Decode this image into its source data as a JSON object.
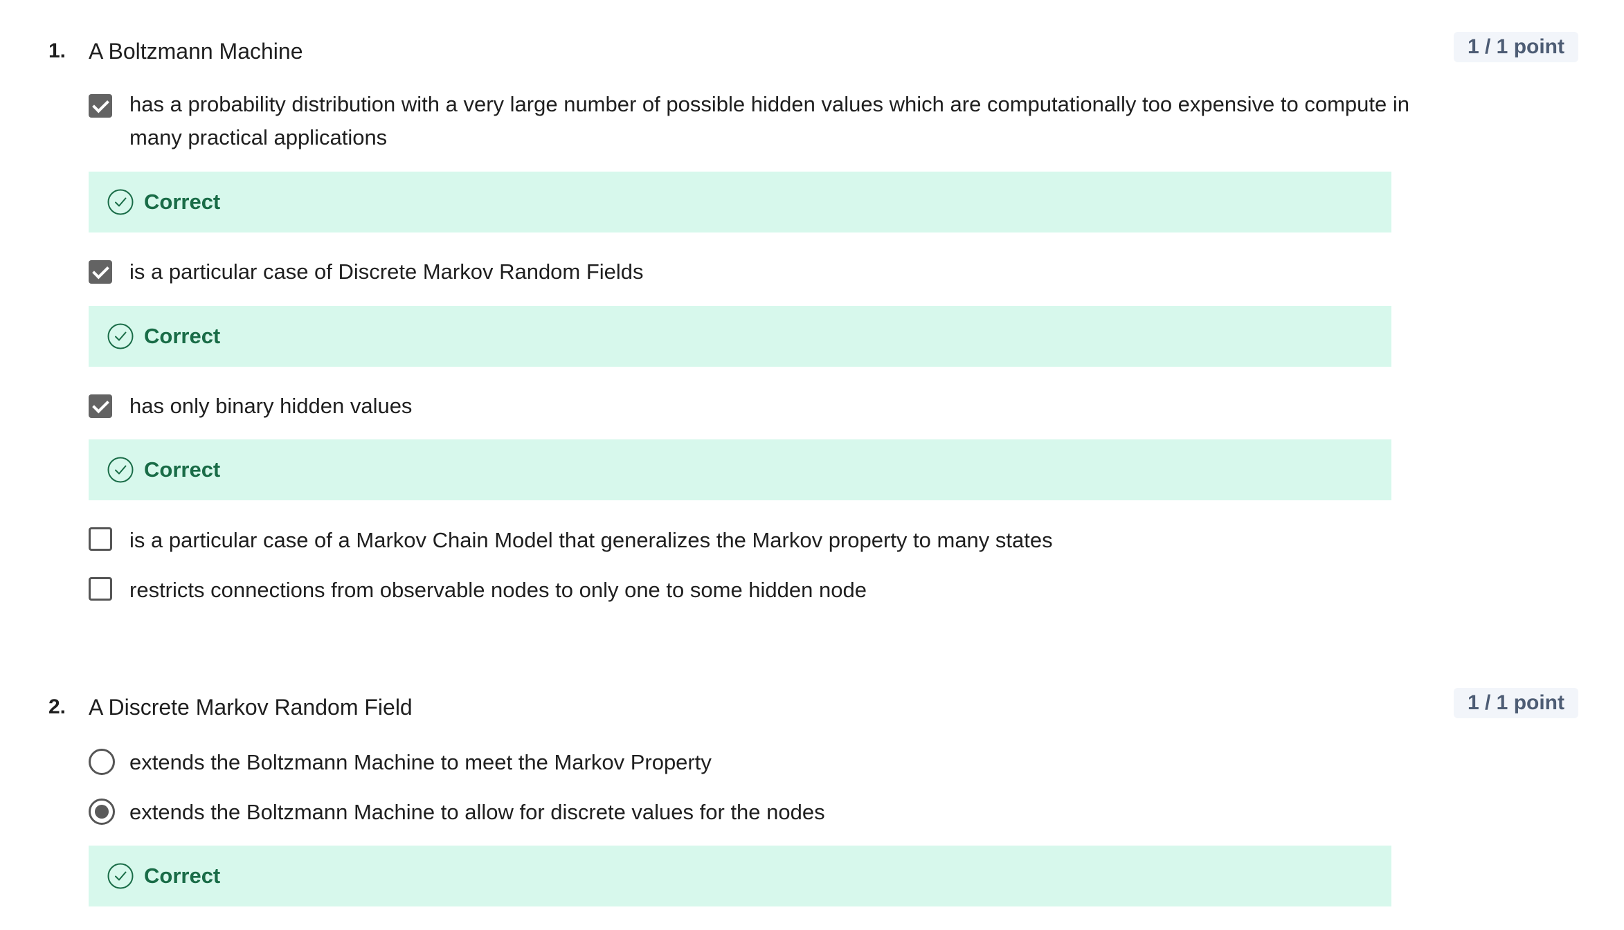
{
  "questions": [
    {
      "number": "1.",
      "title": "A Boltzmann Machine",
      "points": "1 / 1 point",
      "options": [
        {
          "text": "has a probability distribution with a very large number of possible hidden values which are computationally too expensive to compute in many practical applications",
          "state": "checked",
          "feedback": "Correct"
        },
        {
          "text": "is a particular case of Discrete Markov Random Fields",
          "state": "checked",
          "feedback": "Correct"
        },
        {
          "text": "has only binary hidden values",
          "state": "checked",
          "feedback": "Correct"
        },
        {
          "text": "is a particular case of a Markov Chain Model that generalizes the Markov property to many states",
          "state": "unchecked"
        },
        {
          "text": "restricts connections from observable nodes to only one to some hidden node",
          "state": "unchecked"
        }
      ]
    },
    {
      "number": "2.",
      "title": "A Discrete Markov Random Field",
      "points": "1 / 1 point",
      "options": [
        {
          "text": "extends the Boltzmann Machine to meet the Markov Property",
          "state": "unselected"
        },
        {
          "text": "extends the Boltzmann Machine to allow for discrete values for the nodes",
          "state": "selected",
          "feedback": "Correct"
        }
      ]
    }
  ],
  "icons": {
    "feedback": "check-circle-icon",
    "checkbox_checked": "checkbox-checked-icon",
    "checkbox_unchecked": "checkbox-unchecked-icon",
    "radio_selected": "radio-selected-icon",
    "radio_unselected": "radio-unselected-icon"
  },
  "colors": {
    "correct_background": "#d7f8ec",
    "correct_text": "#196c47",
    "badge_background": "#f2f5fa",
    "badge_text": "#4d5c74"
  }
}
